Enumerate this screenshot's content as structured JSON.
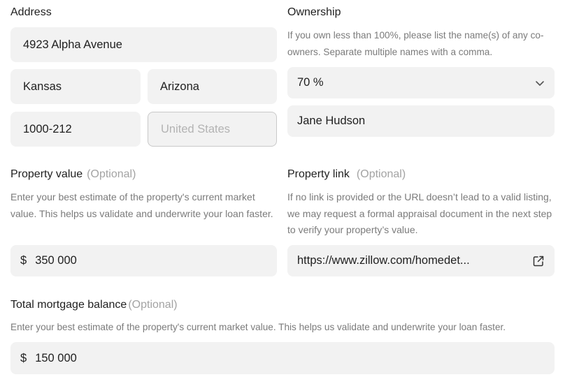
{
  "address": {
    "label": "Address",
    "street": "4923 Alpha Avenue",
    "city": "Kansas",
    "state": "Arizona",
    "zip": "1000-212",
    "country_placeholder": "United States"
  },
  "ownership": {
    "label": "Ownership",
    "help": "If you own less than 100%, please list the name(s) of any co-owners. Separate multiple names with a comma.",
    "percent": "70 %",
    "co_owners": "Jane Hudson"
  },
  "property_value": {
    "label": "Property value",
    "optional": "(Optional)",
    "help": "Enter your best estimate of the property's current market value. This helps us validate and underwrite your loan faster.",
    "currency": "$",
    "value": "350 000"
  },
  "property_link": {
    "label": "Property link",
    "optional": "(Optional)",
    "help": "If no link is provided or the URL doesn’t lead to a valid listing, we may request a formal appraisal document in the next step to verify your property’s value.",
    "value": "https://www.zillow.com/homedet..."
  },
  "mortgage_balance": {
    "label": "Total mortgage balance",
    "optional": "(Optional)",
    "help": "Enter your best estimate of the property's current market value. This helps us validate and underwrite your loan faster.",
    "currency": "$",
    "value": "150 000"
  },
  "icons": {
    "dropdown": "chevron-down-icon",
    "external": "external-link-icon"
  }
}
